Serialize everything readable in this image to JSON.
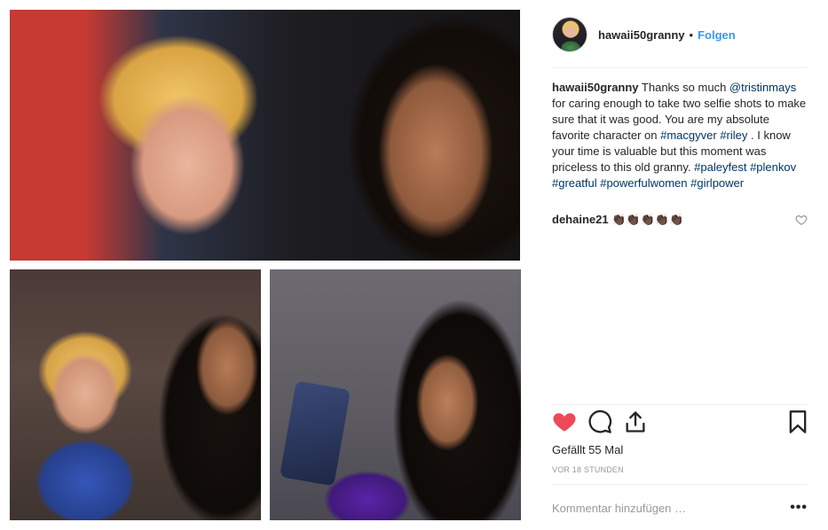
{
  "post": {
    "photos": [
      "selfie-top",
      "selfie-bottom-left",
      "selfie-bottom-right"
    ]
  },
  "header": {
    "username": "hawaii50granny",
    "separator": "•",
    "follow_label": "Folgen"
  },
  "caption": {
    "username": "hawaii50granny",
    "t1": " Thanks so much ",
    "m1": "@tristinmays",
    "t2": " for caring enough to take two selfie shots to make sure that it was good. You are my absolute favorite character on ",
    "h1": "#macgyver",
    "t3": " ",
    "h2": "#riley",
    "t4": " . I know your time is valuable but this moment was priceless to this old granny. ",
    "h3": "#paleyfest",
    "t5": " ",
    "h4": "#plenkov",
    "t6": " ",
    "h5": "#greatful",
    "t7": " ",
    "h6": "#powerfulwomen",
    "t8": " ",
    "h7": "#girlpower"
  },
  "comment": {
    "username": "dehaine21",
    "text": " 👏🏿👏🏿👏🏿👏🏿👏🏿"
  },
  "actions": {
    "like_icon": "heart-icon",
    "comment_icon": "comment-icon",
    "share_icon": "share-icon",
    "save_icon": "bookmark-icon",
    "liked": true,
    "like_color": "#ed4956"
  },
  "likes": {
    "label": "Gefällt 55 Mal"
  },
  "timestamp": {
    "label": "VOR 18 STUNDEN"
  },
  "comment_box": {
    "placeholder": "Kommentar hinzufügen …",
    "more_label": "•••"
  },
  "colors": {
    "accent": "#3897f0",
    "hashtag": "#003569",
    "muted": "#999999"
  }
}
